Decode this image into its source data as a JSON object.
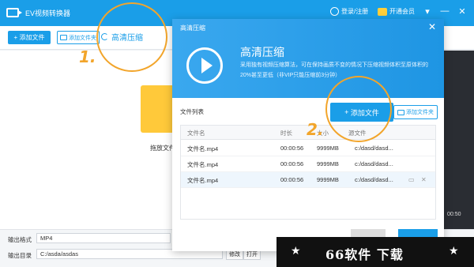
{
  "app": {
    "title": "EV视频转换器"
  },
  "titlebar": {
    "login": "登录/注册",
    "vip": "开通会员",
    "minimize": "—",
    "dropdown": "▾",
    "close": "✕"
  },
  "toolbar": {
    "add_file": "添加文件",
    "add_folder": "添加文件夹",
    "compress_tab": "高清压缩"
  },
  "main": {
    "drag_hint": "拖放文件",
    "preview_time": "00:50"
  },
  "bottom": {
    "format_label": "输出格式",
    "format_value": "MP4",
    "dir_label": "输出目录",
    "dir_value": "C:/asda/asdas",
    "modify": "修改",
    "open": "打开"
  },
  "dialog": {
    "title": "高清压缩",
    "close": "✕",
    "hero_title": "高清压缩",
    "hero_desc": "采用独有视频压缩算法，可在保持画质不变的情况下压缩视频体积至原体积的20%甚至更低（非VIP只能压缩前3分钟）",
    "list_caption": "文件列表",
    "add_file": "添加文件",
    "add_folder": "添加文件夹",
    "columns": [
      "文件名",
      "时长",
      "大小",
      "源文件"
    ],
    "rows": [
      {
        "name": "文件名.mp4",
        "duration": "00:00:56",
        "size": "9999MB",
        "path": "c:/dasd/dasd..."
      },
      {
        "name": "文件名.mp4",
        "duration": "00:00:56",
        "size": "9999MB",
        "path": "c:/dasd/dasd..."
      },
      {
        "name": "文件名.mp4",
        "duration": "00:00:56",
        "size": "9999MB",
        "path": "c:/dasd/dasd..."
      }
    ]
  },
  "annotations": {
    "step1": "1.",
    "step2": "2."
  },
  "watermark": {
    "text": "66软件 下载",
    "star": "★"
  },
  "colors": {
    "primary": "#1a9ee8",
    "annotation": "#f2a52b",
    "folder": "#ffc93a"
  }
}
